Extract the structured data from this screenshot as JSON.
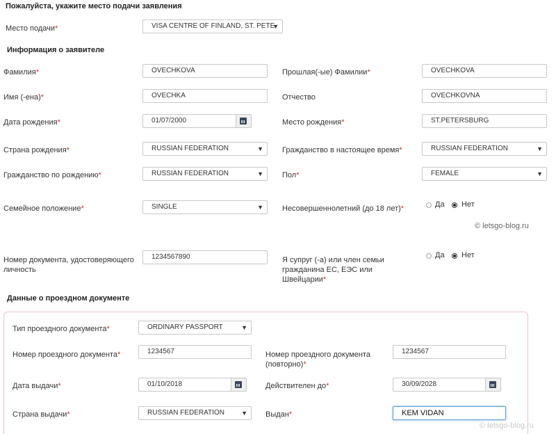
{
  "sections": {
    "submission": "Пожалуйста, укажите место подачи заявления",
    "applicant": "Информация о заявителе",
    "travel_doc": "Данные о проездном документе"
  },
  "submission": {
    "place_label": "Место подачи",
    "place_value": "VISA CENTRE OF FINLAND, ST. PETE"
  },
  "applicant": {
    "surname_label": "Фамилия",
    "surname_value": "OVECHKOVA",
    "prev_surname_label": "Прошлая(-ые) Фамилии",
    "prev_surname_value": "OVECHKOVA",
    "name_label": "Имя (-ена)",
    "name_value": "OVECHKA",
    "patronymic_label": "Отчество",
    "patronymic_value": "OVECHKOVNA",
    "dob_label": "Дата рождения",
    "dob_value": "01/07/2000",
    "birthplace_label": "Место рождения",
    "birthplace_value": "ST.PETERSBURG",
    "birth_country_label": "Страна рождения",
    "birth_country_value": "RUSSIAN FEDERATION",
    "citizenship_label": "Гражданство в настоящее время",
    "citizenship_value": "RUSSIAN FEDERATION",
    "birth_citizenship_label": "Гражданство по рождению",
    "birth_citizenship_value": "RUSSIAN FEDERATION",
    "sex_label": "Пол",
    "sex_value": "FEMALE",
    "marital_label": "Семейное положение",
    "marital_value": "SINGLE",
    "minor_label": "Несовершеннолетний (до 18 лет)",
    "doc_label_1": "Номер документа, удостоверяющего",
    "doc_label_2": "личность",
    "doc_value": "1234567890",
    "eu_label_1": "Я супруг (-а) или член семьи",
    "eu_label_2": "гражданина ЕС, ЕЭС или",
    "eu_label_3": "Швейцарии"
  },
  "radio": {
    "yes": "Да",
    "no": "Нет"
  },
  "travel": {
    "type_label": "Тип проездного документа",
    "type_value": "ORDINARY PASSPORT",
    "number_label": "Номер проездного документа",
    "number_value": "1234567",
    "number_repeat_label_1": "Номер проездного документа",
    "number_repeat_label_2": "(повторно)",
    "number_repeat_value": "1234567",
    "issue_date_label": "Дата выдачи",
    "issue_date_value": "01/10/2018",
    "valid_until_label": "Действителен до",
    "valid_until_value": "30/09/2028",
    "issue_country_label": "Страна выдачи",
    "issue_country_value": "RUSSIAN FEDERATION",
    "issued_by_label": "Выдан",
    "issued_by_value": "KEM VIDAN"
  },
  "req_mark": "*",
  "watermark": "© letsgo-blog.ru"
}
